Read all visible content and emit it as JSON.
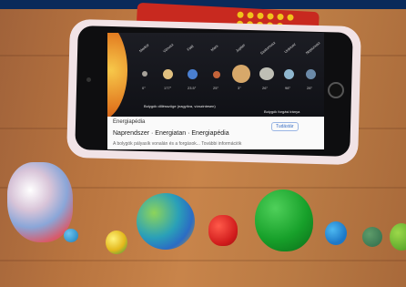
{
  "screen": {
    "planet_labels": [
      "Merkúr",
      "Vénusz",
      "Föld",
      "Mars",
      "Jupiter",
      "Szaturnusz",
      "Uránusz",
      "Neptunusz"
    ],
    "planet_numbers": [
      "0°",
      "177°",
      "23.5°",
      "25°",
      "3°",
      "26°",
      "98°",
      "28°"
    ],
    "legend_left": "Bolygók dőlésszöge (nagyítva, vízszintesen)",
    "legend_right": "Bolygók forgási iránya",
    "app_name": "Energiapédia",
    "breadcrumb": "Naprendszer · Energiatan · Energiapédia",
    "button": "Tudástár",
    "caption": "A bolygók pályasík vonalán és a forgások...  További információk"
  }
}
